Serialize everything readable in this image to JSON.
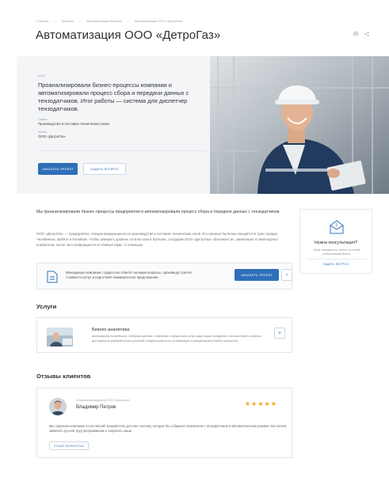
{
  "breadcrumb": [
    "Главная",
    "Проекты",
    "Автоматизация бизнеса",
    "Автоматизация ООО «ДетроГаз»"
  ],
  "page": {
    "title": "Автоматизация ООО «ДетроГаз»",
    "icons": [
      "print-icon",
      "share-icon"
    ]
  },
  "hero": {
    "year": "2018",
    "lead": "Проанализировали бизнес-процессы компании и автоматизировали процесс сбора и передачи данных с тензодатчиков. Итог работы — система для диспетчер тензодатчиков.",
    "field_label": "Сфера",
    "field_value": "Производство и поставка технических газов",
    "client_label": "Клиент",
    "client_value": "ООО «ДетроГаз»",
    "order_button": "ЗАКАЗАТЬ ПРОЕКТ",
    "ask_button": "ЗАДАТЬ ВОПРОС"
  },
  "content": {
    "intro": "Мы проанализировали бизнес-процессы предприятия и автоматизировали процесс сбора и передачи данных с тензодатчиков.",
    "description": "ООО «ДетроГаз» — предприятие, специализирующееся на производстве и поставке технических газов. Его газовые баллоны находятся в трех городах: Челябинске, Ирбите и Копейске. Чтобы замерить уровень остатка газа в баллоне, сотрудник ООО «ДетроГаз» объезжает их, записывает в свой журнал показатели, после чего возвращается в главный офис. С помощью"
  },
  "consult": {
    "title": "Нужна консультация?",
    "text": "Наши специалисты ответят на любой интересующий вопрос",
    "link": "ЗАДАТЬ ВОПРОС"
  },
  "calc": {
    "text": "Менеджеры компании с радостью ответят на ваши вопросы, произведут расчет стоимости услуг и подготовят коммерческое предложение.",
    "button": "ЗАКАЗАТЬ ПРОЕКТ",
    "arrow": "›"
  },
  "services": {
    "title": "Услуги",
    "items": [
      {
        "title": "Бизнес-аналитика",
        "description": "Анализируем потребности, собираем данные о компании и предлагаем услуги двух видов: внедрение системы бизнес-анализа для принятия управленческих решений и ведем проекты по оптимизации и реинжинирингу бизнес-процессов.",
        "expand": "+"
      }
    ]
  },
  "reviews": {
    "title": "Отзывы клиентов",
    "items": [
      {
        "role": "Генеральный директор ООО «Детрогаз»",
        "name": "Владимир Петров",
        "rating": 5,
        "star": "★",
        "text": "Мы поручили компании Астро Инсайт разработать для нас систему, которая бы собирала показатели с тензодатчиков в автоматическом режиме. Мы хотели заменить ручной труд программным и сократить наши",
        "more": "ОТЗЫВ ПОЛНОСТЬЮ"
      }
    ]
  },
  "colors": {
    "accent": "#2f6fb8",
    "star": "#f2a51a",
    "hero_bg": "#f4f5f7"
  }
}
